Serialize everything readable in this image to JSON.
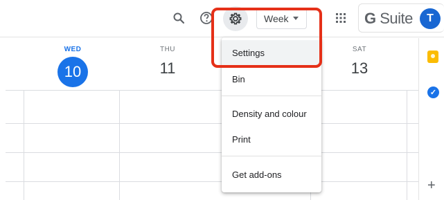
{
  "header": {
    "icons": [
      "search-icon",
      "help-icon",
      "gear-icon",
      "apps-grid-icon"
    ],
    "view_select": {
      "selected": "Week"
    },
    "brand": {
      "g": "G",
      "suite": " Suite"
    },
    "avatar_initial": "T"
  },
  "days": [
    {
      "name": "WED",
      "number": "10",
      "today": true
    },
    {
      "name": "THU",
      "number": "11",
      "today": false
    },
    {
      "name": "SAT",
      "number": "13",
      "today": false
    }
  ],
  "settings_menu": {
    "items": [
      {
        "label": "Settings",
        "highlighted": true
      },
      {
        "label": "Bin"
      },
      {
        "label": "Density and colour"
      },
      {
        "label": "Print"
      },
      {
        "label": "Get add-ons"
      }
    ]
  },
  "side_panel": {
    "icons": [
      "keep-icon",
      "tasks-icon",
      "add-icon"
    ],
    "add_label": "+"
  },
  "colors": {
    "accent": "#1a73e8",
    "highlight": "#e53018",
    "keep": "#fbbc04"
  }
}
